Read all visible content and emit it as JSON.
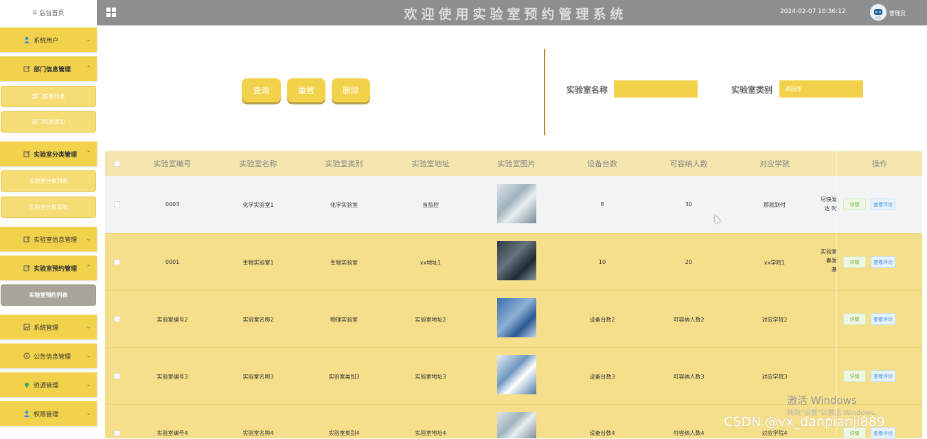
{
  "sidebar": {
    "home": "后台首页",
    "menus": [
      {
        "label": "系统用户",
        "icon": "user-icon",
        "chevron": "⌄"
      },
      {
        "label": "部门信息管理",
        "icon": "edit-icon",
        "chevron": "⌃"
      },
      {
        "label": "实验室分类管理",
        "icon": "edit-icon",
        "chevron": "⌃"
      },
      {
        "label": "实验室信息管理",
        "icon": "edit-icon",
        "chevron": "⌄"
      },
      {
        "label": "实验室预约管理",
        "icon": "edit-icon",
        "chevron": "⌃"
      },
      {
        "label": "系统管理",
        "icon": "image-icon",
        "chevron": "⌄"
      },
      {
        "label": "公告信息管理",
        "icon": "info-icon",
        "chevron": "⌄"
      },
      {
        "label": "资源管理",
        "icon": "pin-icon",
        "chevron": "⌄"
      },
      {
        "label": "权限管理",
        "icon": "user-icon",
        "chevron": "⌄"
      }
    ],
    "subs": [
      {
        "label": "部门信息列表"
      },
      {
        "label": "部门信息添加"
      },
      {
        "label": "实验室分类列表"
      },
      {
        "label": "实验室分类添加"
      },
      {
        "label": "实验室预约列表"
      }
    ]
  },
  "header": {
    "title": "欢迎使用实验室预约管理系统",
    "datetime": "2024-02-07 10:36:12",
    "user": "管理员"
  },
  "search": {
    "query_button": "查询",
    "reset_button": "重置",
    "delete_button": "删除",
    "name_label": "实验室名称",
    "category_label": "实验室类别",
    "category_placeholder": "请选择"
  },
  "table": {
    "headers": [
      "实验室编号",
      "实验室名称",
      "实验室类别",
      "实验室地址",
      "实验室图片",
      "设备台数",
      "可容纳人数",
      "对应学院",
      "操作"
    ],
    "rows": [
      {
        "id": "0003",
        "name": "化学实验室1",
        "category": "化学实验室",
        "address": "当监控",
        "devices": "8",
        "capacity": "30",
        "college": "那就到付",
        "extra1": "尽快发",
        "extra2": "达 时"
      },
      {
        "id": "0001",
        "name": "生物实验室1",
        "category": "生物实验室",
        "address": "xx地址1",
        "devices": "10",
        "capacity": "20",
        "college": "xx学院1",
        "extra1": "实验室",
        "extra2": "春发",
        "extra3": "基"
      },
      {
        "id": "实验室编号2",
        "name": "实验室名称2",
        "category": "物理实验室",
        "address": "实验室地址2",
        "devices": "设备台数2",
        "capacity": "可容纳人数2",
        "college": "对应学院2"
      },
      {
        "id": "实验室编号3",
        "name": "实验室名称3",
        "category": "实验室类别3",
        "address": "实验室地址3",
        "devices": "设备台数3",
        "capacity": "可容纳人数3",
        "college": "对应学院3"
      },
      {
        "id": "实验室编号4",
        "name": "实验室名称4",
        "category": "实验室类别4",
        "address": "实验室地址4",
        "devices": "设备台数4",
        "capacity": "可容纳人数4",
        "college": "对应学院4"
      }
    ],
    "detail_label": "详情",
    "review_label": "查看评论"
  },
  "overlay": {
    "win1": "激活 Windows",
    "win2": "转到\"设置\"以激活 Windows。",
    "csdn": "CSDN @vx_danpianji889"
  },
  "colors": {
    "accent": "#f2d24b",
    "topbar": "#8f8f8f",
    "header_row": "#f4e6ae"
  }
}
